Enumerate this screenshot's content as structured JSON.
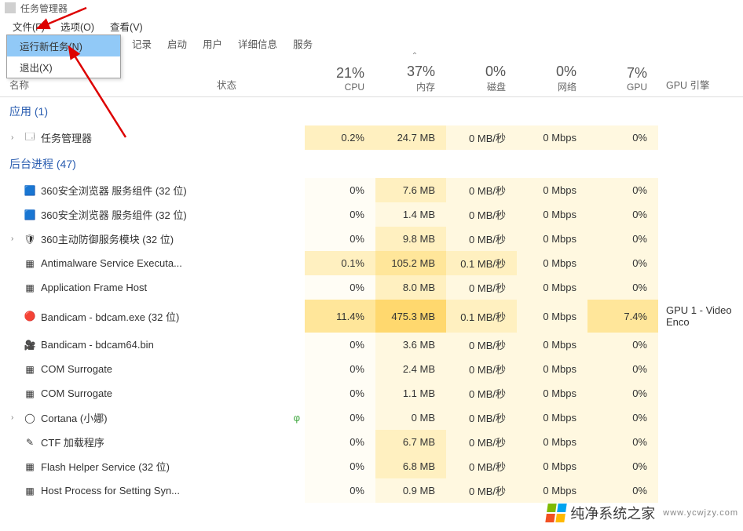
{
  "window": {
    "title": "任务管理器"
  },
  "menubar": {
    "file": "文件(F)",
    "options": "选项(O)",
    "view": "查看(V)"
  },
  "dropdown": {
    "run_new_task": "运行新任务(N)",
    "exit": "退出(X)"
  },
  "tabs_partial": {
    "history_suffix": "记录",
    "startup": "启动",
    "users": "用户",
    "details": "详细信息",
    "services": "服务"
  },
  "columns": {
    "name": "名称",
    "status": "状态",
    "cpu_pct": "21%",
    "cpu_lbl": "CPU",
    "mem_pct": "37%",
    "mem_lbl": "内存",
    "disk_pct": "0%",
    "disk_lbl": "磁盘",
    "net_pct": "0%",
    "net_lbl": "网络",
    "gpu_pct": "7%",
    "gpu_lbl": "GPU",
    "gpu_engine": "GPU 引擎"
  },
  "groups": {
    "apps": "应用 (1)",
    "bg": "后台进程 (47)"
  },
  "rows": [
    {
      "expand": "›",
      "icon": "tm",
      "name": "任务管理器",
      "cpu": "0.2%",
      "mem": "24.7 MB",
      "disk": "0 MB/秒",
      "net": "0 Mbps",
      "gpu": "0%",
      "engine": "",
      "heat": {
        "cpu": "h2",
        "mem": "h2",
        "disk": "h1",
        "net": "h1",
        "gpu": "h1"
      }
    },
    {
      "expand": "",
      "icon": "ie",
      "name": "360安全浏览器 服务组件 (32 位)",
      "cpu": "0%",
      "mem": "7.6 MB",
      "disk": "0 MB/秒",
      "net": "0 Mbps",
      "gpu": "0%",
      "engine": "",
      "heat": {
        "cpu": "h0",
        "mem": "h2",
        "disk": "h1",
        "net": "h1",
        "gpu": "h1"
      }
    },
    {
      "expand": "",
      "icon": "ie",
      "name": "360安全浏览器 服务组件 (32 位)",
      "cpu": "0%",
      "mem": "1.4 MB",
      "disk": "0 MB/秒",
      "net": "0 Mbps",
      "gpu": "0%",
      "engine": "",
      "heat": {
        "cpu": "h0",
        "mem": "h1",
        "disk": "h1",
        "net": "h1",
        "gpu": "h1"
      }
    },
    {
      "expand": "›",
      "icon": "shield",
      "name": "360主动防御服务模块 (32 位)",
      "cpu": "0%",
      "mem": "9.8 MB",
      "disk": "0 MB/秒",
      "net": "0 Mbps",
      "gpu": "0%",
      "engine": "",
      "heat": {
        "cpu": "h0",
        "mem": "h2",
        "disk": "h1",
        "net": "h1",
        "gpu": "h1"
      }
    },
    {
      "expand": "",
      "icon": "win",
      "name": "Antimalware Service Executa...",
      "cpu": "0.1%",
      "mem": "105.2 MB",
      "disk": "0.1 MB/秒",
      "net": "0 Mbps",
      "gpu": "0%",
      "engine": "",
      "heat": {
        "cpu": "h2",
        "mem": "h3",
        "disk": "h2",
        "net": "h1",
        "gpu": "h1"
      }
    },
    {
      "expand": "",
      "icon": "win",
      "name": "Application Frame Host",
      "cpu": "0%",
      "mem": "8.0 MB",
      "disk": "0 MB/秒",
      "net": "0 Mbps",
      "gpu": "0%",
      "engine": "",
      "heat": {
        "cpu": "h0",
        "mem": "h2",
        "disk": "h1",
        "net": "h1",
        "gpu": "h1"
      }
    },
    {
      "expand": "",
      "icon": "rec",
      "name": "Bandicam - bdcam.exe (32 位)",
      "cpu": "11.4%",
      "mem": "475.3 MB",
      "disk": "0.1 MB/秒",
      "net": "0 Mbps",
      "gpu": "7.4%",
      "engine": "GPU 1 - Video Enco",
      "heat": {
        "cpu": "h3",
        "mem": "h4",
        "disk": "h2",
        "net": "h1",
        "gpu": "h3"
      }
    },
    {
      "expand": "",
      "icon": "bd",
      "name": "Bandicam - bdcam64.bin",
      "cpu": "0%",
      "mem": "3.6 MB",
      "disk": "0 MB/秒",
      "net": "0 Mbps",
      "gpu": "0%",
      "engine": "",
      "heat": {
        "cpu": "h0",
        "mem": "h1",
        "disk": "h1",
        "net": "h1",
        "gpu": "h1"
      }
    },
    {
      "expand": "",
      "icon": "win",
      "name": "COM Surrogate",
      "cpu": "0%",
      "mem": "2.4 MB",
      "disk": "0 MB/秒",
      "net": "0 Mbps",
      "gpu": "0%",
      "engine": "",
      "heat": {
        "cpu": "h0",
        "mem": "h1",
        "disk": "h1",
        "net": "h1",
        "gpu": "h1"
      }
    },
    {
      "expand": "",
      "icon": "win",
      "name": "COM Surrogate",
      "cpu": "0%",
      "mem": "1.1 MB",
      "disk": "0 MB/秒",
      "net": "0 Mbps",
      "gpu": "0%",
      "engine": "",
      "heat": {
        "cpu": "h0",
        "mem": "h1",
        "disk": "h1",
        "net": "h1",
        "gpu": "h1"
      }
    },
    {
      "expand": "›",
      "icon": "cortana",
      "name": "Cortana (小娜)",
      "cpu": "0%",
      "mem": "0 MB",
      "disk": "0 MB/秒",
      "net": "0 Mbps",
      "gpu": "0%",
      "engine": "",
      "heat": {
        "cpu": "h0",
        "mem": "h1",
        "disk": "h1",
        "net": "h1",
        "gpu": "h1"
      },
      "leaf": "🌱"
    },
    {
      "expand": "",
      "icon": "ctf",
      "name": "CTF 加载程序",
      "cpu": "0%",
      "mem": "6.7 MB",
      "disk": "0 MB/秒",
      "net": "0 Mbps",
      "gpu": "0%",
      "engine": "",
      "heat": {
        "cpu": "h0",
        "mem": "h2",
        "disk": "h1",
        "net": "h1",
        "gpu": "h1"
      }
    },
    {
      "expand": "",
      "icon": "flash",
      "name": "Flash Helper Service (32 位)",
      "cpu": "0%",
      "mem": "6.8 MB",
      "disk": "0 MB/秒",
      "net": "0 Mbps",
      "gpu": "0%",
      "engine": "",
      "heat": {
        "cpu": "h0",
        "mem": "h2",
        "disk": "h1",
        "net": "h1",
        "gpu": "h1"
      }
    },
    {
      "expand": "",
      "icon": "win",
      "name": "Host Process for Setting Syn...",
      "cpu": "0%",
      "mem": "0.9 MB",
      "disk": "0 MB/秒",
      "net": "0 Mbps",
      "gpu": "0%",
      "engine": "",
      "heat": {
        "cpu": "h0",
        "mem": "h1",
        "disk": "h1",
        "net": "h1",
        "gpu": "h1"
      }
    }
  ],
  "watermark": {
    "text": "纯净系统之家",
    "url": "www.ycwjzy.com"
  }
}
